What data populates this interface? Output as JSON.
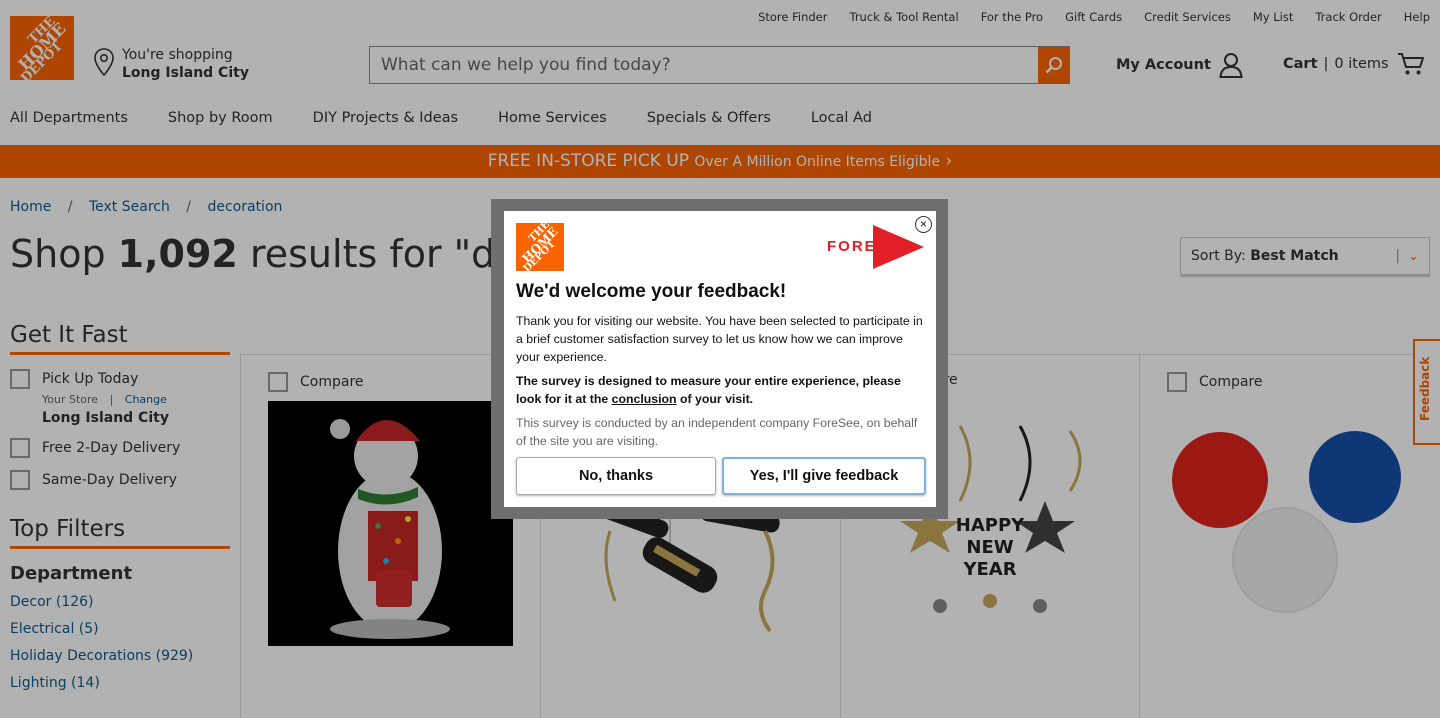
{
  "utility_nav": [
    "Store Finder",
    "Truck & Tool Rental",
    "For the Pro",
    "Gift Cards",
    "Credit Services",
    "My List",
    "Track Order",
    "Help"
  ],
  "logo": {
    "line1": "THE",
    "line2": "HOME",
    "line3": "DEPOT"
  },
  "store": {
    "label": "You're shopping",
    "name": "Long Island City"
  },
  "search": {
    "placeholder": "What can we help you find today?"
  },
  "account": {
    "label": "My Account"
  },
  "cart": {
    "label": "Cart",
    "separator": "|",
    "count": "0 items"
  },
  "main_nav": [
    "All Departments",
    "Shop by Room",
    "DIY Projects & Ideas",
    "Home Services",
    "Specials & Offers",
    "Local Ad"
  ],
  "promo": {
    "main": "FREE IN-STORE PICK UP",
    "sub": "Over A Million Online Items Eligible",
    "arrow": "›"
  },
  "breadcrumb": {
    "items": [
      "Home",
      "Text Search",
      "decoration"
    ],
    "separator": "/"
  },
  "results": {
    "prefix": "Shop",
    "count": "1,092",
    "suffix": "results for \"decorat"
  },
  "sort": {
    "label": "Sort By:",
    "value": "Best Match"
  },
  "sidebar": {
    "get_it_fast": "Get It Fast",
    "pick_up_today": "Pick Up Today",
    "your_store": "Your Store",
    "divider": "|",
    "change": "Change",
    "store_name": "Long Island City",
    "free_delivery": "Free 2-Day Delivery",
    "same_day": "Same-Day Delivery",
    "top_filters": "Top Filters",
    "department": "Department",
    "departments": [
      "Decor (126)",
      "Electrical (5)",
      "Holiday Decorations (929)",
      "Lighting (14)"
    ]
  },
  "products": {
    "compare_label": "Compare",
    "compare_partial": "are"
  },
  "feedback_tab": "Feedback",
  "survey": {
    "brand": "FORESEE",
    "title": "We'd welcome your feedback!",
    "p1": "Thank you for visiting our website. You have been selected to participate in a brief customer satisfaction survey to let us know how we can improve your experience.",
    "p2_before": "The survey is designed to measure your entire experience, please look for it at the ",
    "p2_link": "conclusion",
    "p2_after": " of your visit.",
    "p3": "This survey is conducted by an independent company ForeSee, on behalf of the site you are visiting.",
    "no_button": "No, thanks",
    "yes_button": "Yes, I'll give feedback",
    "close": "×"
  },
  "colors": {
    "brand_orange": "#f96302",
    "link_blue": "#0f5a8e",
    "foresee_red": "#e21e26"
  }
}
